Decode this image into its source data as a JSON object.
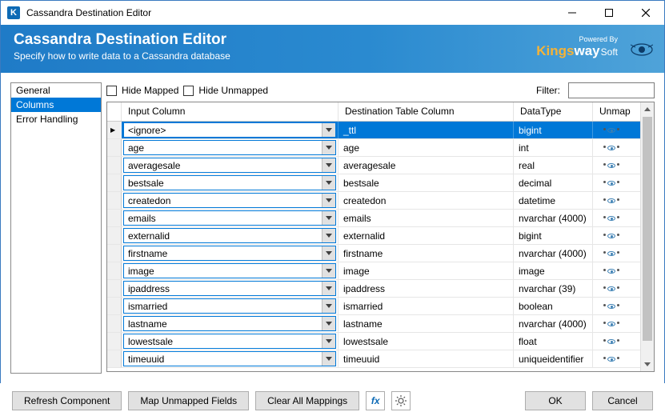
{
  "window": {
    "title": "Cassandra Destination Editor"
  },
  "header": {
    "title": "Cassandra Destination Editor",
    "subtitle": "Specify how to write data to a Cassandra database",
    "powered_by": "Powered By",
    "brand_a": "Kings",
    "brand_b": "way",
    "brand_c": "Soft"
  },
  "sidebar": {
    "items": [
      "General",
      "Columns",
      "Error Handling"
    ],
    "selected_index": 1
  },
  "toolbar": {
    "hide_mapped": "Hide Mapped",
    "hide_unmapped": "Hide Unmapped",
    "filter_label": "Filter:",
    "filter_value": ""
  },
  "grid": {
    "headers": {
      "input": "Input Column",
      "dest": "Destination Table Column",
      "datatype": "DataType",
      "unmap": "Unmap"
    },
    "rows": [
      {
        "input": "<ignore>",
        "dest": "_ttl",
        "type": "bigint",
        "selected": true
      },
      {
        "input": "age",
        "dest": "age",
        "type": "int",
        "selected": false
      },
      {
        "input": "averagesale",
        "dest": "averagesale",
        "type": "real",
        "selected": false
      },
      {
        "input": "bestsale",
        "dest": "bestsale",
        "type": "decimal",
        "selected": false
      },
      {
        "input": "createdon",
        "dest": "createdon",
        "type": "datetime",
        "selected": false
      },
      {
        "input": "emails",
        "dest": "emails",
        "type": "nvarchar (4000)",
        "selected": false
      },
      {
        "input": "externalid",
        "dest": "externalid",
        "type": "bigint",
        "selected": false
      },
      {
        "input": "firstname",
        "dest": "firstname",
        "type": "nvarchar (4000)",
        "selected": false
      },
      {
        "input": "image",
        "dest": "image",
        "type": "image",
        "selected": false
      },
      {
        "input": "ipaddress",
        "dest": "ipaddress",
        "type": "nvarchar (39)",
        "selected": false
      },
      {
        "input": "ismarried",
        "dest": "ismarried",
        "type": "boolean",
        "selected": false
      },
      {
        "input": "lastname",
        "dest": "lastname",
        "type": "nvarchar (4000)",
        "selected": false
      },
      {
        "input": "lowestsale",
        "dest": "lowestsale",
        "type": "float",
        "selected": false
      },
      {
        "input": "timeuuid",
        "dest": "timeuuid",
        "type": "uniqueidentifier",
        "selected": false
      }
    ]
  },
  "footer": {
    "refresh": "Refresh Component",
    "map_unmapped": "Map Unmapped Fields",
    "clear_all": "Clear All Mappings",
    "ok": "OK",
    "cancel": "Cancel"
  }
}
